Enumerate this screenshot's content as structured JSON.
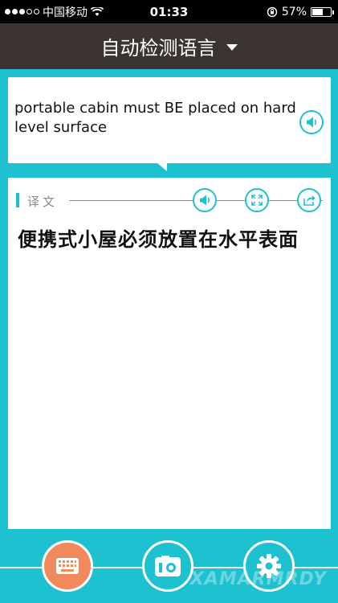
{
  "status_bar": {
    "carrier": "中国移动",
    "time": "01:33",
    "battery": "57%",
    "battery_level": 0.57
  },
  "header": {
    "language_selector": "自动检测语言"
  },
  "source": {
    "text": "portable cabin must BE placed on hard level surface"
  },
  "result": {
    "label": "译文",
    "text": "便携式小屋必须放置在水平表面"
  },
  "watermark": "XAMARMRDY",
  "colors": {
    "accent": "#1ec1cf",
    "header_bg": "#3b3431",
    "keyboard_button": "#f08a5d"
  }
}
